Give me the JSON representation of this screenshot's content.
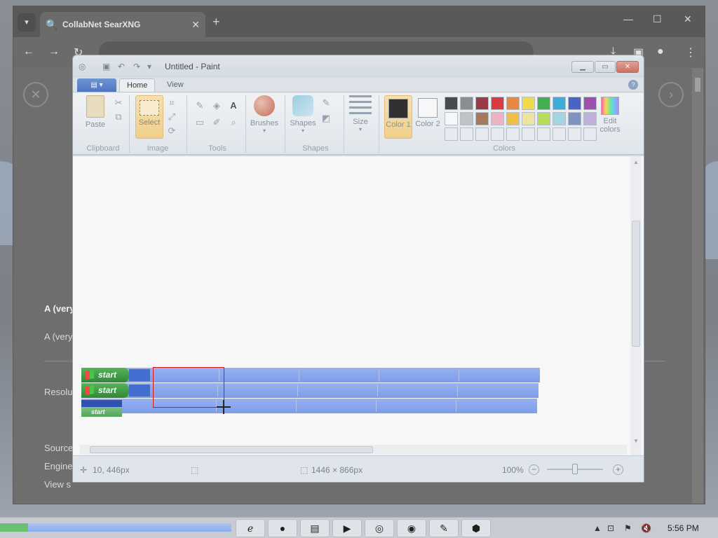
{
  "browser": {
    "tab_title": "CollabNet SearXNG",
    "new_tab": "+",
    "results": {
      "result_title": "A (very",
      "result_snippet": "A (very",
      "resolution_label": "Resolu",
      "source_label": "Source",
      "engine_label": "Engine",
      "view_label": "View s"
    }
  },
  "paint": {
    "title": "Untitled - Paint",
    "tabs": [
      "Home",
      "View"
    ],
    "groups": {
      "clipboard": "Clipboard",
      "image": "Image",
      "tools": "Tools",
      "shapes": "Shapes",
      "colors": "Colors"
    },
    "buttons": {
      "paste": "Paste",
      "select": "Select",
      "brushes": "Brushes",
      "shapes": "Shapes",
      "size": "Size",
      "color1": "Color 1",
      "color2": "Color 2",
      "edit_colors": "Edit colors"
    },
    "palette_row1": [
      "#4a4a4a",
      "#8f8f8f",
      "#9c3a44",
      "#e0393e",
      "#ef8a3e",
      "#f7e04a",
      "#3fb34f",
      "#3ab0e0",
      "#4a63c8",
      "#a24eb0"
    ],
    "palette_row2": [
      "#ffffff",
      "#c7c7c7",
      "#a87a5c",
      "#f5b6c8",
      "#f6c34a",
      "#f4eca0",
      "#b7e35a",
      "#a6dce8",
      "#7f95c6",
      "#c6b4e0"
    ],
    "color1": "#2e2e2e",
    "color2": "#ffffff",
    "pasted": {
      "start_label": "start"
    },
    "status": {
      "cursor_pos": "10, 446px",
      "image_size": "1446 × 866px",
      "zoom": "100%"
    }
  },
  "taskbar": {
    "clock": "5:56 PM"
  }
}
